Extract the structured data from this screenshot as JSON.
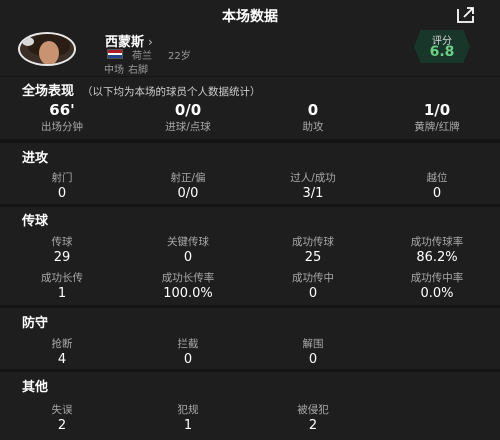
{
  "header": {
    "title": "本场数据",
    "share_icon": "share-icon"
  },
  "player": {
    "name": "西蒙斯",
    "chevron": "›",
    "nationality": "荷兰",
    "age": "22岁",
    "position": "中场",
    "foot": "右脚",
    "flag_colors": [
      "#ae1c28",
      "#ffffff",
      "#21468b"
    ]
  },
  "rating": {
    "label": "评分",
    "value": "6.8",
    "color": "#6ccf82"
  },
  "overview": {
    "title": "全场表现",
    "note": "（以下均为本场的球员个人数据统计）",
    "stats": [
      {
        "value": "66'",
        "label": "出场分钟"
      },
      {
        "value": "0/0",
        "label": "进球/点球"
      },
      {
        "value": "0",
        "label": "助攻"
      },
      {
        "value": "1/0",
        "label": "黄牌/红牌"
      }
    ]
  },
  "attack": {
    "title": "进攻",
    "stats": [
      {
        "label": "射门",
        "value": "0"
      },
      {
        "label": "射正/偏",
        "value": "0/0"
      },
      {
        "label": "过人/成功",
        "value": "3/1"
      },
      {
        "label": "越位",
        "value": "0"
      }
    ]
  },
  "passing": {
    "title": "传球",
    "row1": [
      {
        "label": "传球",
        "value": "29"
      },
      {
        "label": "关键传球",
        "value": "0"
      },
      {
        "label": "成功传球",
        "value": "25"
      },
      {
        "label": "成功传球率",
        "value": "86.2%"
      }
    ],
    "row2": [
      {
        "label": "成功长传",
        "value": "1"
      },
      {
        "label": "成功长传率",
        "value": "100.0%"
      },
      {
        "label": "成功传中",
        "value": "0"
      },
      {
        "label": "成功传中率",
        "value": "0.0%"
      }
    ]
  },
  "defense": {
    "title": "防守",
    "stats": [
      {
        "label": "抢断",
        "value": "4"
      },
      {
        "label": "拦截",
        "value": "0"
      },
      {
        "label": "解围",
        "value": "0"
      }
    ]
  },
  "other": {
    "title": "其他",
    "stats": [
      {
        "label": "失误",
        "value": "2"
      },
      {
        "label": "犯规",
        "value": "1"
      },
      {
        "label": "被侵犯",
        "value": "2"
      }
    ]
  }
}
